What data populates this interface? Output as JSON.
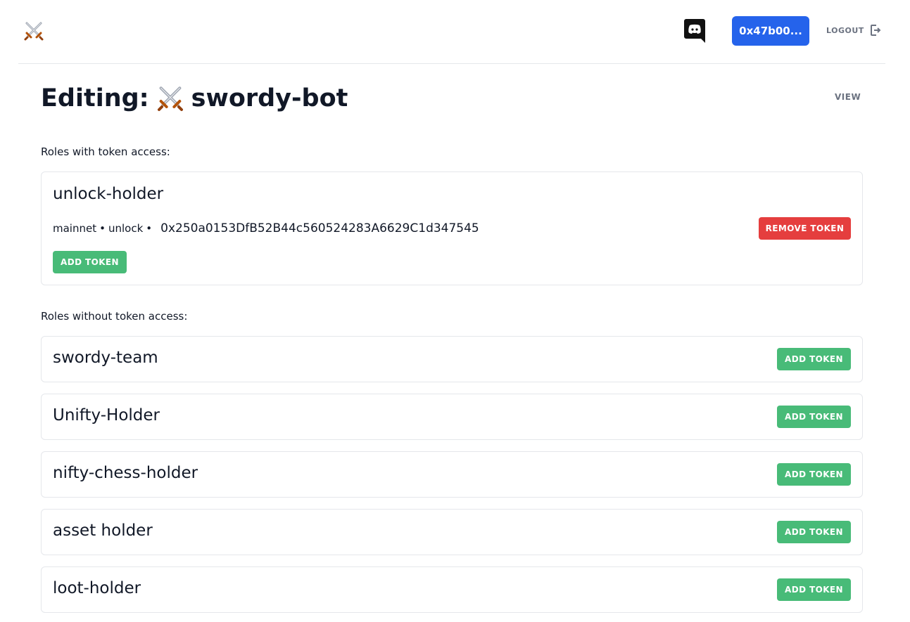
{
  "header": {
    "logo_icon": "crossed-swords-icon",
    "discord_icon": "discord-icon",
    "wallet_label": "0x47b00...",
    "logout_label": "LOGOUT",
    "logout_icon": "logout-icon",
    "accent_color": "#2563eb"
  },
  "page": {
    "title_prefix": "Editing:",
    "title_icon": "crossed-swords-icon",
    "title_name": "swordy-bot",
    "view_label": "VIEW"
  },
  "with_access": {
    "label": "Roles with token access:",
    "roles": [
      {
        "name": "unlock-holder",
        "network": "mainnet",
        "separator": "•",
        "token_name": "unlock",
        "address": "0x250a0153DfB52B44c560524283A6629C1d347545",
        "remove_label": "REMOVE TOKEN",
        "add_label": "ADD TOKEN"
      }
    ]
  },
  "without_access": {
    "label": "Roles without token access:",
    "roles": [
      {
        "name": "swordy-team",
        "add_label": "ADD TOKEN"
      },
      {
        "name": "Unifty-Holder",
        "add_label": "ADD TOKEN"
      },
      {
        "name": "nifty-chess-holder",
        "add_label": "ADD TOKEN"
      },
      {
        "name": "asset holder",
        "add_label": "ADD TOKEN"
      },
      {
        "name": "loot-holder",
        "add_label": "ADD TOKEN"
      }
    ]
  },
  "colors": {
    "add_button": "#48bb78",
    "remove_button": "#e53e3e"
  }
}
